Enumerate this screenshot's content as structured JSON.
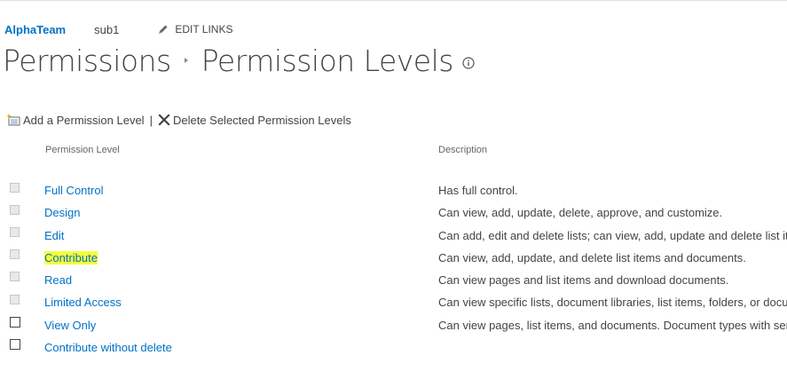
{
  "topnav": {
    "site": "AlphaTeam",
    "subsite": "sub1",
    "edit_links": "EDIT LINKS"
  },
  "breadcrumb": {
    "parent": "Permissions",
    "current": "Permission Levels"
  },
  "toolbar": {
    "add_label": "Add a Permission Level",
    "separator": "|",
    "delete_label": "Delete Selected Permission Levels"
  },
  "table": {
    "headers": {
      "level": "Permission Level",
      "description": "Description"
    },
    "rows": [
      {
        "name": "Full Control",
        "description": "Has full control.",
        "checkbox": "disabled",
        "highlighted": false
      },
      {
        "name": "Design",
        "description": "Can view, add, update, delete, approve, and customize.",
        "checkbox": "disabled",
        "highlighted": false
      },
      {
        "name": "Edit",
        "description": "Can add, edit and delete lists; can view, add, update and delete list ite",
        "checkbox": "disabled",
        "highlighted": false
      },
      {
        "name": "Contribute",
        "description": "Can view, add, update, and delete list items and documents.",
        "checkbox": "disabled",
        "highlighted": true
      },
      {
        "name": "Read",
        "description": "Can view pages and list items and download documents.",
        "checkbox": "disabled",
        "highlighted": false
      },
      {
        "name": "Limited Access",
        "description": "Can view specific lists, document libraries, list items, folders, or docu",
        "checkbox": "disabled",
        "highlighted": false
      },
      {
        "name": "View Only",
        "description": "Can view pages, list items, and documents. Document types with serv",
        "checkbox": "enabled",
        "highlighted": false
      },
      {
        "name": "Contribute without delete",
        "description": "",
        "checkbox": "enabled",
        "highlighted": false
      }
    ]
  },
  "icons": {
    "edit_links": "pencil-icon",
    "breadcrumb_separator": "triangle-right-icon",
    "info": "info-icon",
    "add": "add-permission-level-icon",
    "delete": "delete-x-icon"
  },
  "colors": {
    "link": "#0072c6",
    "text": "#444444",
    "highlight": "#f5ff3a"
  }
}
